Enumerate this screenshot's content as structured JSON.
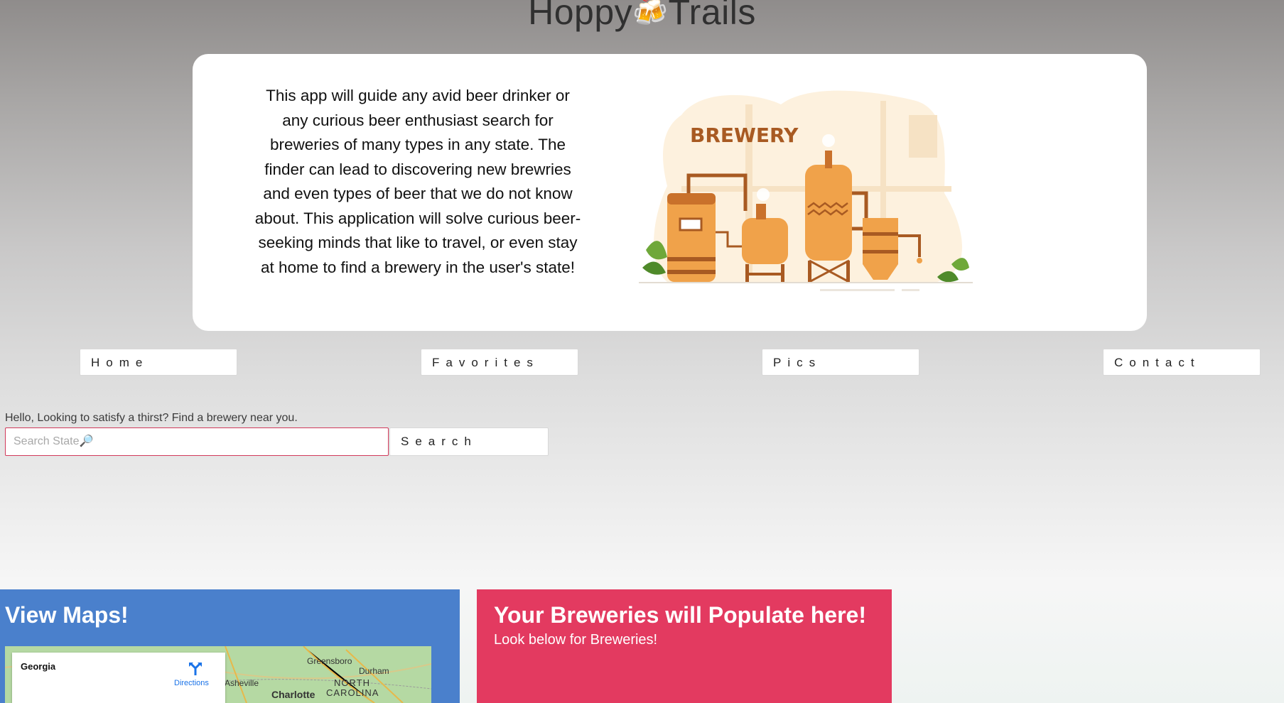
{
  "header": {
    "title_left": "Hoppy",
    "title_icon": "🍻",
    "title_right": "Trails"
  },
  "hero": {
    "description": "This app will guide any avid beer drinker or any curious beer enthusiast search for breweries of many types in any state. The finder can lead to discovering new brewries and even types of beer that we do not know about. This application will solve curious beer-seeking minds that like to travel, or even stay at home to find a brewery in the user's state!",
    "illustration_sign": "BREWERY",
    "colors": {
      "tank": "#f0a24a",
      "tank_dark": "#a85a22",
      "backdrop": "#fdf1de",
      "leaf": "#6fa83a"
    }
  },
  "nav": {
    "home": "Home",
    "favorites": "Favorites",
    "pics": "Pics",
    "contact": "Contact"
  },
  "search": {
    "greeting": "Hello, Looking to satisfy a thirst? Find a brewery near you.",
    "placeholder": "Search State🔎",
    "button": "Search"
  },
  "maps": {
    "title": "View Maps!",
    "place": "Georgia",
    "directions": "Directions",
    "labels": [
      "Greensboro",
      "Durham",
      "Asheville",
      "Charlotte",
      "NORTH",
      "CAROLINA"
    ]
  },
  "breweries": {
    "title": "Your Breweries will Populate here!",
    "subtitle": "Look below for Breweries!"
  },
  "colors": {
    "maps_card": "#4a80cc",
    "breweries_card": "#e33a60",
    "input_border": "#d13a5b"
  }
}
